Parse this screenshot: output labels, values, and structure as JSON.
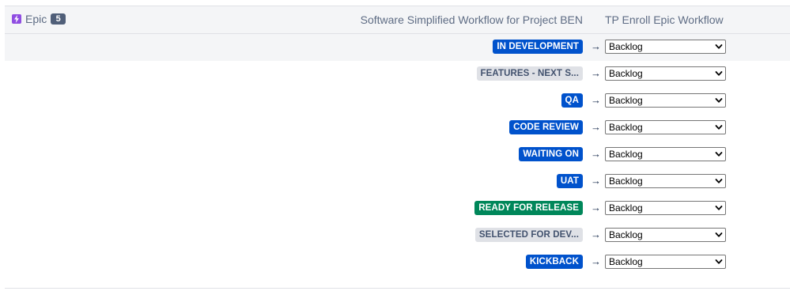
{
  "header": {
    "issue_type": {
      "label": "Epic",
      "count": "5",
      "icon": "lightning-icon",
      "icon_color": "#904ee2"
    },
    "source_column": "Software Simplified Workflow for Project BEN",
    "target_column": "TP Enroll Epic Workflow"
  },
  "colors": {
    "blue_lozenge": "#0052cc",
    "green_lozenge": "#00875a",
    "grey_lozenge": "#dfe1e6"
  },
  "mappings": [
    {
      "status": "IN DEVELOPMENT",
      "color": "blue",
      "selected": "Backlog"
    },
    {
      "status": "FEATURES - NEXT S...",
      "color": "grey",
      "selected": "Backlog"
    },
    {
      "status": "QA",
      "color": "blue",
      "selected": "Backlog"
    },
    {
      "status": "CODE REVIEW",
      "color": "blue",
      "selected": "Backlog"
    },
    {
      "status": "WAITING ON",
      "color": "blue",
      "selected": "Backlog"
    },
    {
      "status": "UAT",
      "color": "blue",
      "selected": "Backlog"
    },
    {
      "status": "READY FOR RELEASE",
      "color": "green",
      "selected": "Backlog"
    },
    {
      "status": "SELECTED FOR DEV...",
      "color": "grey",
      "selected": "Backlog"
    },
    {
      "status": "KICKBACK",
      "color": "blue",
      "selected": "Backlog"
    }
  ],
  "arrow_symbol": "→"
}
